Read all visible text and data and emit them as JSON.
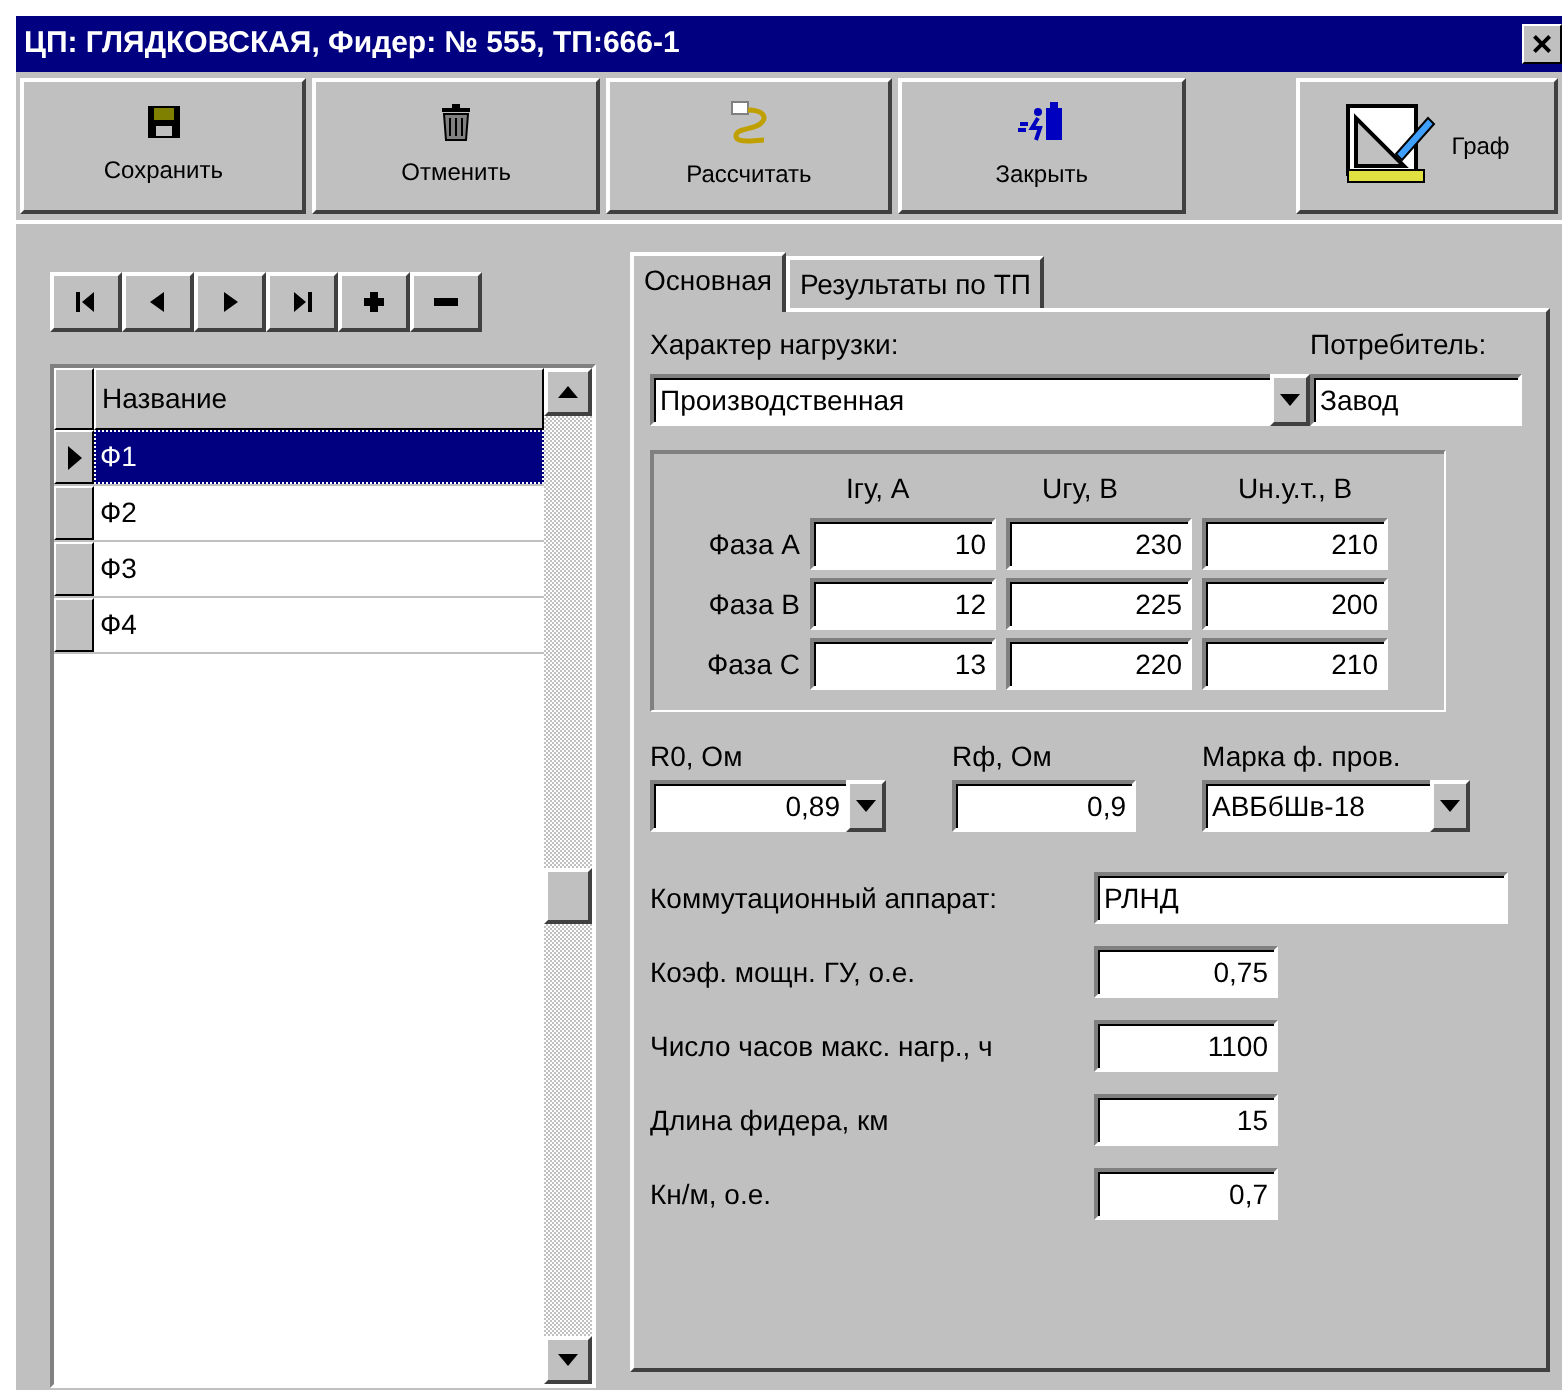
{
  "window": {
    "title": "ЦП: ГЛЯДКОВСКАЯ, Фидер: №  555, ТП:666-1",
    "close": "×"
  },
  "toolbar": [
    {
      "kind": "save",
      "label": "Сохранить"
    },
    {
      "kind": "delete",
      "label": "Отменить"
    },
    {
      "kind": "calculate",
      "label": "Рассчитать"
    },
    {
      "kind": "close",
      "label": "Закрыть"
    },
    {
      "kind": "graph",
      "label": "Граф"
    }
  ],
  "navigator": [
    {
      "kind": "first"
    },
    {
      "kind": "prior"
    },
    {
      "kind": "next"
    },
    {
      "kind": "last"
    },
    {
      "kind": "insert"
    },
    {
      "kind": "delete"
    }
  ],
  "grid": {
    "columns": [
      "Название"
    ],
    "rows": [
      {
        "name": "Ф1",
        "selected": true
      },
      {
        "name": "Ф2",
        "selected": false
      },
      {
        "name": "Ф3",
        "selected": false
      },
      {
        "name": "Ф4",
        "selected": false
      }
    ]
  },
  "tabs": [
    {
      "label": "Основная",
      "selected": true
    },
    {
      "label": "Результаты по ТП",
      "selected": false
    }
  ],
  "load_type": {
    "label": "Характер нагрузки:",
    "value": "Производственная"
  },
  "consumer": {
    "label": "Потребитель:",
    "value": "Завод"
  },
  "phases": {
    "columns": [
      "Iгу, А",
      "Uгу, В",
      "Uн.у.т., В"
    ],
    "rows": [
      {
        "label": "Фаза А",
        "values": [
          "10",
          "230",
          "210"
        ]
      },
      {
        "label": "Фаза В",
        "values": [
          "12",
          "225",
          "200"
        ]
      },
      {
        "label": "Фаза С",
        "values": [
          "13",
          "220",
          "210"
        ]
      }
    ]
  },
  "params": [
    {
      "kind": "combo",
      "label": "R0, Ом",
      "value": "0,89"
    },
    {
      "kind": "edit",
      "label": "Rф, Ом",
      "value": "0,9"
    },
    {
      "kind": "combo",
      "label": "Марка ф. пров.",
      "value": "АВБбШв-18"
    }
  ],
  "fields": [
    {
      "kind": "wide",
      "label": "Коммутационный аппарат:",
      "value": "РЛНД"
    },
    {
      "kind": "number",
      "label": "Коэф. мощн. ГУ, о.е.",
      "value": "0,75"
    },
    {
      "kind": "number",
      "label": "Число часов макс. нагр., ч",
      "value": "1100"
    },
    {
      "kind": "number",
      "label": "Длина фидера, км",
      "value": "15"
    },
    {
      "kind": "number",
      "label": "Кн/м, о.е.",
      "value": "0,7"
    }
  ]
}
